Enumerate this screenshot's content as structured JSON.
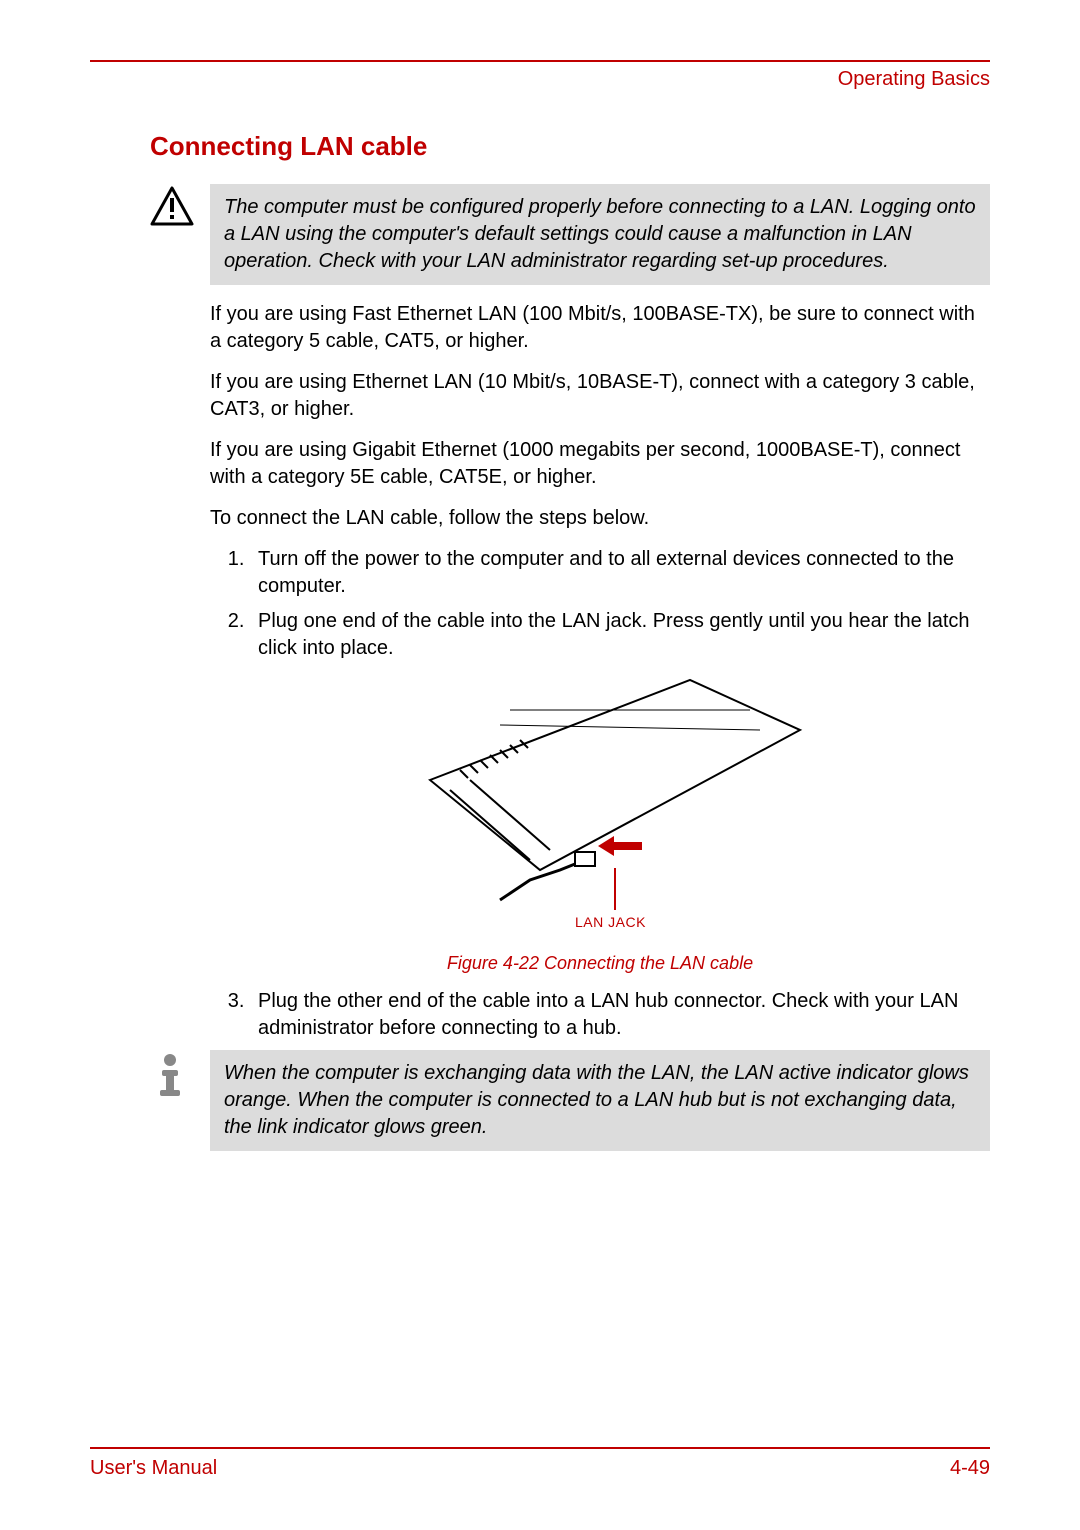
{
  "header": {
    "section": "Operating Basics"
  },
  "title": "Connecting LAN cable",
  "warning": "The computer must be configured properly before connecting to a LAN. Logging onto a LAN using the computer's default settings could cause a malfunction in LAN operation. Check with your LAN administrator regarding set-up procedures.",
  "paragraphs": {
    "p1": "If you are using Fast Ethernet LAN (100 Mbit/s, 100BASE-TX), be sure to connect with a category 5 cable, CAT5, or higher.",
    "p2": "If you are using Ethernet LAN (10 Mbit/s, 10BASE-T), connect with a category 3 cable, CAT3, or higher.",
    "p3": "If you are using Gigabit Ethernet (1000 megabits per second, 1000BASE-T), connect with a category 5E cable, CAT5E, or higher.",
    "p4": "To connect the LAN cable, follow the steps below."
  },
  "steps": {
    "s1": "Turn off the power to the computer and to all external devices connected to the computer.",
    "s2": "Plug one end of the cable into the LAN jack. Press gently until you hear the latch click into place.",
    "s3": "Plug the other end of the cable into a LAN hub connector. Check with your LAN administrator before connecting to a hub."
  },
  "figure": {
    "label": "LAN JACK",
    "caption": "Figure 4-22 Connecting the LAN cable"
  },
  "note": "When the computer is exchanging data with the LAN, the LAN active indicator glows orange. When the computer is connected to a LAN hub but is not exchanging data, the link indicator glows green.",
  "footer": {
    "left": "User's Manual",
    "right": "4-49"
  }
}
